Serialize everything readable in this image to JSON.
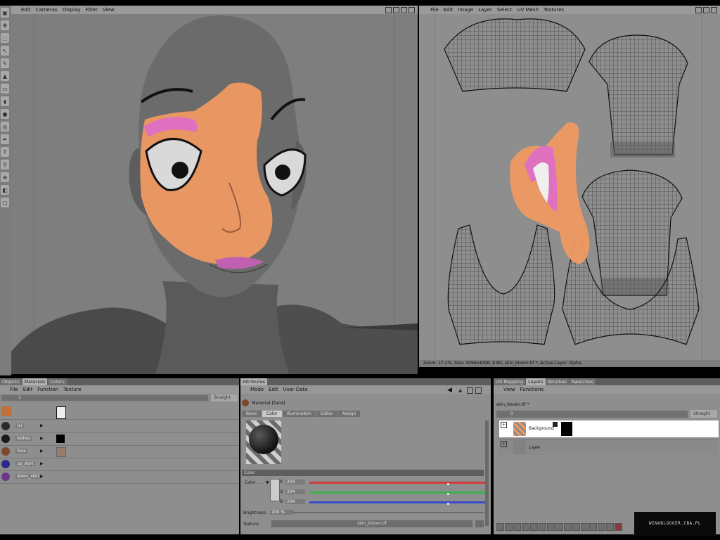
{
  "viewport": {
    "menu": [
      "Edit",
      "Cameras",
      "Display",
      "Filter",
      "View"
    ]
  },
  "uv_editor": {
    "menu": [
      "File",
      "Edit",
      "Image",
      "Layer",
      "Select",
      "UV Mesh",
      "Textures"
    ],
    "status": "Zoom: 17.2%, Size: 4096x4096, 8 Bit, skin_bloom.tif *, Active Layer: Alpha"
  },
  "materials_panel": {
    "tabs": [
      "Objects",
      "Materials",
      "Colors"
    ],
    "menu": [
      "File",
      "Edit",
      "Function",
      "Texture"
    ],
    "search_value": "1",
    "blend_mode": "Straight",
    "materials": [
      {
        "name": "(s)",
        "color": "#2a2a2a"
      },
      {
        "name": "lashes",
        "color": "#1a1a1a"
      },
      {
        "name": "face",
        "color": "#7a4a2a"
      },
      {
        "name": "up_skirt",
        "color": "#2a2a8a"
      },
      {
        "name": "down_skirt",
        "color": "#6a3a8a"
      }
    ]
  },
  "attributes_panel": {
    "tab": "Attributes",
    "menu": [
      "Mode",
      "Edit",
      "User Data"
    ],
    "material_title": "Material [face]",
    "buttons": [
      "Basic",
      "Color",
      "Illumination",
      "Editor",
      "Assign"
    ],
    "section": "Color",
    "color_label": "Color . . .",
    "r_label": "R",
    "r_value": "204",
    "g_label": "G",
    "g_value": "204",
    "b_label": "B",
    "b_value": "204",
    "brightness_label": "Brightness",
    "brightness_value": "100 %",
    "texture_label": "Texture",
    "texture_value": "skin_bloom.tif"
  },
  "layers_panel": {
    "tabs": [
      "UV Mapping",
      "Layers",
      "Brushes",
      "Swatches"
    ],
    "menu": [
      "View",
      "Functions"
    ],
    "file": "skin_bloom.tif *",
    "value": "0",
    "blend_mode": "Straight",
    "layers": [
      "Background",
      "Layer"
    ]
  },
  "watermark": "WINXBLOGGER.CBA.PL",
  "colors": {
    "accent_red": "#d23a3a",
    "accent_green": "#3ab04a",
    "accent_blue": "#3a4ac8",
    "paint_orange": "#ef9a62",
    "paint_pink": "#e070c0"
  }
}
